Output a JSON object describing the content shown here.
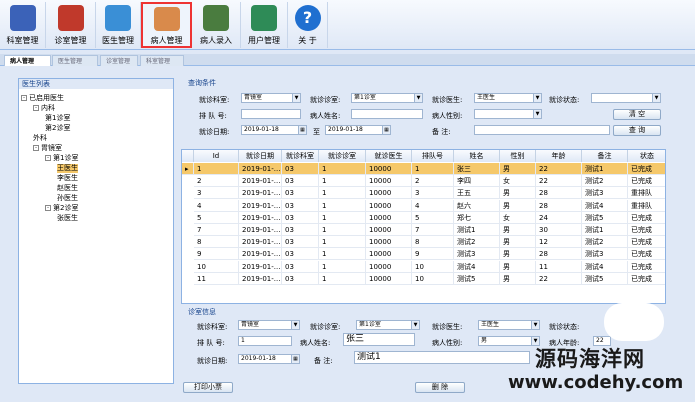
{
  "toolbar": [
    {
      "label": "科室管理",
      "icon": "building-grid-icon",
      "color": "#3b62b8"
    },
    {
      "label": "诊室管理",
      "icon": "medical-kit-icon",
      "color": "#c0392b"
    },
    {
      "label": "医生管理",
      "icon": "doctor-icon",
      "color": "#3a8fd6"
    },
    {
      "label": "病人管理",
      "icon": "patient-icon",
      "color": "#d98a4b",
      "active": true
    },
    {
      "label": "病人录入",
      "icon": "patient-add-icon",
      "color": "#4a7c3f"
    },
    {
      "label": "用户管理",
      "icon": "users-icon",
      "color": "#2e8b57"
    },
    {
      "label": "关 于",
      "icon": "help-question-icon",
      "color": "#1f6fd0"
    }
  ],
  "tabs": [
    "病人管理",
    "医生管理",
    "诊室管理",
    "科室管理"
  ],
  "tree": {
    "title": "医生列表",
    "nodes": [
      {
        "label": "已启用医生",
        "level": 0,
        "expander": "-"
      },
      {
        "label": "内科",
        "level": 1,
        "expander": "-"
      },
      {
        "label": "第1诊室",
        "level": 2
      },
      {
        "label": "第2诊室",
        "level": 2
      },
      {
        "label": "外科",
        "level": 1
      },
      {
        "label": "胃镜室",
        "level": 1,
        "expander": "-"
      },
      {
        "label": "第1诊室",
        "level": 2,
        "expander": "-"
      },
      {
        "label": "王医生",
        "level": 3,
        "selected": true
      },
      {
        "label": "李医生",
        "level": 3
      },
      {
        "label": "赵医生",
        "level": 3
      },
      {
        "label": "孙医生",
        "level": 3
      },
      {
        "label": "第2诊室",
        "level": 2,
        "expander": "-"
      },
      {
        "label": "张医生",
        "level": 3
      }
    ]
  },
  "query": {
    "title": "查询条件",
    "dept_label": "就诊科室:",
    "dept_value": "胃镜室",
    "room_label": "就诊诊室:",
    "room_value": "第1诊室",
    "doctor_label": "就诊医生:",
    "doctor_value": "王医生",
    "status_label": "就诊状态:",
    "status_value": "",
    "queue_label": "排 队 号:",
    "name_label": "病人姓名:",
    "gender_label": "病人性别:",
    "date_label": "就诊日期:",
    "date_from": "2019-01-18",
    "date_to_label": "至",
    "date_to": "2019-01-18",
    "remark_label": "备    注:",
    "clear_button": "清 空",
    "search_button": "查 询"
  },
  "grid": {
    "columns": [
      "Id",
      "就诊日期",
      "就诊科室",
      "就诊诊室",
      "就诊医生",
      "排队号",
      "姓名",
      "性别",
      "年龄",
      "备注",
      "状态"
    ],
    "rows": [
      [
        "1",
        "2019-01-...",
        "03",
        "1",
        "10000",
        "1",
        "张三",
        "男",
        "22",
        "测试1",
        "已完成"
      ],
      [
        "2",
        "2019-01-...",
        "03",
        "1",
        "10000",
        "2",
        "李四",
        "女",
        "22",
        "测试2",
        "已完成"
      ],
      [
        "3",
        "2019-01-...",
        "03",
        "1",
        "10000",
        "3",
        "王五",
        "男",
        "28",
        "测试3",
        "重排队"
      ],
      [
        "4",
        "2019-01-...",
        "03",
        "1",
        "10000",
        "4",
        "赵六",
        "男",
        "28",
        "测试4",
        "重排队"
      ],
      [
        "5",
        "2019-01-...",
        "03",
        "1",
        "10000",
        "5",
        "郑七",
        "女",
        "24",
        "测试5",
        "已完成"
      ],
      [
        "7",
        "2019-01-...",
        "03",
        "1",
        "10000",
        "7",
        "测试1",
        "男",
        "30",
        "测试1",
        "已完成"
      ],
      [
        "8",
        "2019-01-...",
        "03",
        "1",
        "10000",
        "8",
        "测试2",
        "男",
        "12",
        "测试2",
        "已完成"
      ],
      [
        "9",
        "2019-01-...",
        "03",
        "1",
        "10000",
        "9",
        "测试3",
        "男",
        "28",
        "测试3",
        "已完成"
      ],
      [
        "10",
        "2019-01-...",
        "03",
        "1",
        "10000",
        "10",
        "测试4",
        "男",
        "11",
        "测试4",
        "已完成"
      ],
      [
        "11",
        "2019-01-...",
        "03",
        "1",
        "10000",
        "10",
        "测试5",
        "男",
        "22",
        "测试5",
        "已完成"
      ]
    ]
  },
  "detail": {
    "title": "诊室信息",
    "dept_label": "就诊科室:",
    "dept_value": "胃镜室",
    "room_label": "就诊诊室:",
    "room_value": "第1诊室",
    "doctor_label": "就诊医生:",
    "doctor_value": "王医生",
    "status_label": "就诊状态:",
    "queue_label": "排 队 号:",
    "queue_value": "1",
    "name_label": "病人姓名:",
    "name_value": "张三",
    "gender_label": "病人性别:",
    "gender_value": "男",
    "age_label": "病人年龄:",
    "age_value": "22",
    "date_label": "就诊日期:",
    "date_value": "2019-01-18",
    "remark_label": "备    注:",
    "remark_value": "测试1"
  },
  "buttons": {
    "print": "打印小票",
    "delete": "删 除"
  },
  "watermark": {
    "line1": "源码海洋网",
    "line2": "www.codehy.com"
  }
}
